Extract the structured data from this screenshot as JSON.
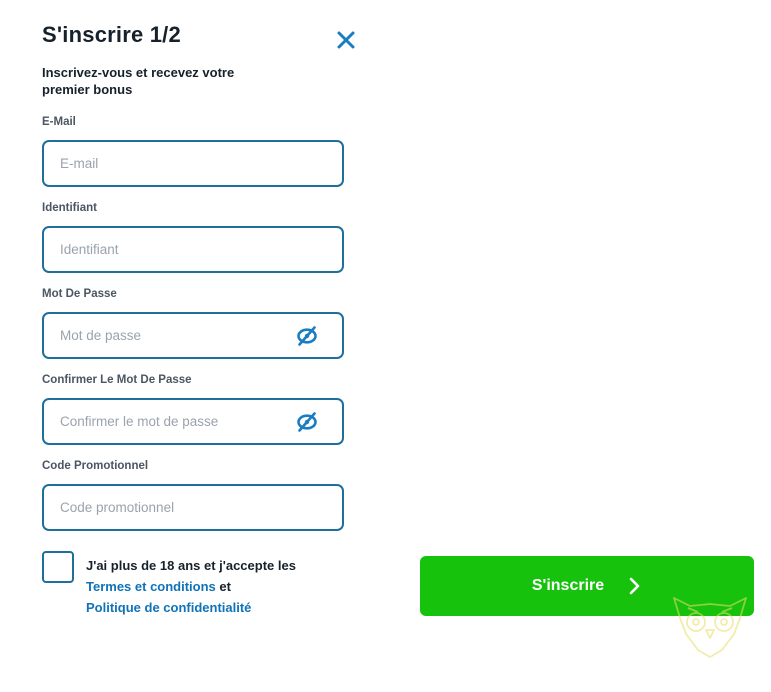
{
  "header": {
    "title": "S'inscrire 1/2",
    "subtitle": "Inscrivez-vous et recevez votre premier bonus"
  },
  "form": {
    "email": {
      "label": "E-Mail",
      "placeholder": "E-mail",
      "value": ""
    },
    "username": {
      "label": "Identifiant",
      "placeholder": "Identifiant",
      "value": ""
    },
    "password": {
      "label": "Mot De Passe",
      "placeholder": "Mot de passe",
      "value": ""
    },
    "confirm_password": {
      "label": "Confirmer Le Mot De Passe",
      "placeholder": "Confirmer le mot de passe",
      "value": ""
    },
    "promo": {
      "label": "Code Promotionnel",
      "placeholder": "Code promotionnel",
      "value": ""
    }
  },
  "consent": {
    "checked": false,
    "text": "J'ai plus de 18 ans et j'accepte les",
    "terms_link": "Termes et conditions",
    "and": "et",
    "privacy_link": "Politique de confidentialité"
  },
  "submit": {
    "label": "S'inscrire"
  },
  "icons": {
    "close": "close-icon",
    "password_toggle": "eye-slash-icon",
    "submit_arrow": "chevron-right-icon",
    "watermark": "owl-logo"
  },
  "colors": {
    "primary_blue": "#1f6f9b",
    "link_blue": "#0f73b8",
    "submit_green": "#16c20c",
    "text_dark": "#17212b",
    "placeholder": "#9aa3ad"
  }
}
